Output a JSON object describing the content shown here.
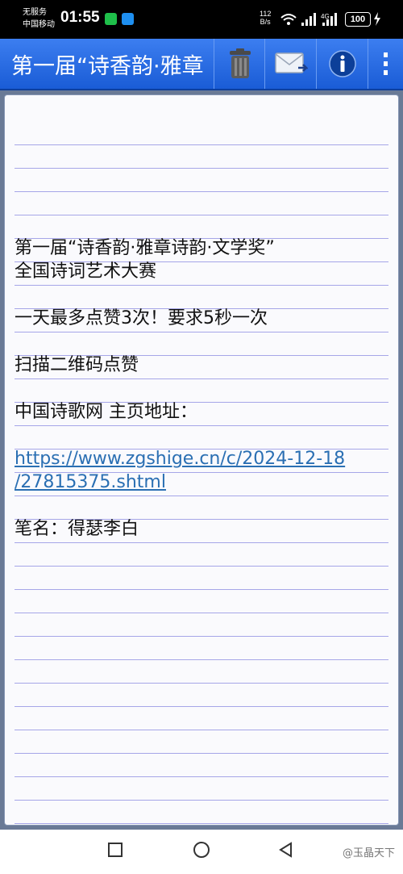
{
  "status_bar": {
    "carrier_line1": "无服务",
    "carrier_line2": "中国移动",
    "time": "01:55",
    "net_speed_value": "112",
    "net_speed_unit": "B/s",
    "battery": "100"
  },
  "app_bar": {
    "title": "第一届“诗香韵·雅章"
  },
  "note": {
    "line1": "第一届“诗香韵·雅章诗韵·文学奖”",
    "line2": "全国诗词艺术大赛",
    "line3": "一天最多点赞3次！要求5秒一次",
    "line4": "扫描二维码点赞",
    "line5": "中国诗歌网 主页地址：",
    "link_part1": "https://www.zgshige.cn/c/2024-12-18",
    "link_part2": "/27815375.shtml",
    "line6": "笔名：得瑟李白"
  },
  "watermark": "@玉晶天下",
  "colors": {
    "app_bar": "#2a6de6",
    "rule_line": "#a6a6e8",
    "link": "#2a6fb3"
  },
  "icons": [
    "wechat-icon",
    "message-icon",
    "wifi-icon",
    "signal-icon",
    "trash-icon",
    "mail-icon",
    "info-icon",
    "overflow-menu-icon",
    "recents-icon",
    "home-icon",
    "back-icon"
  ]
}
